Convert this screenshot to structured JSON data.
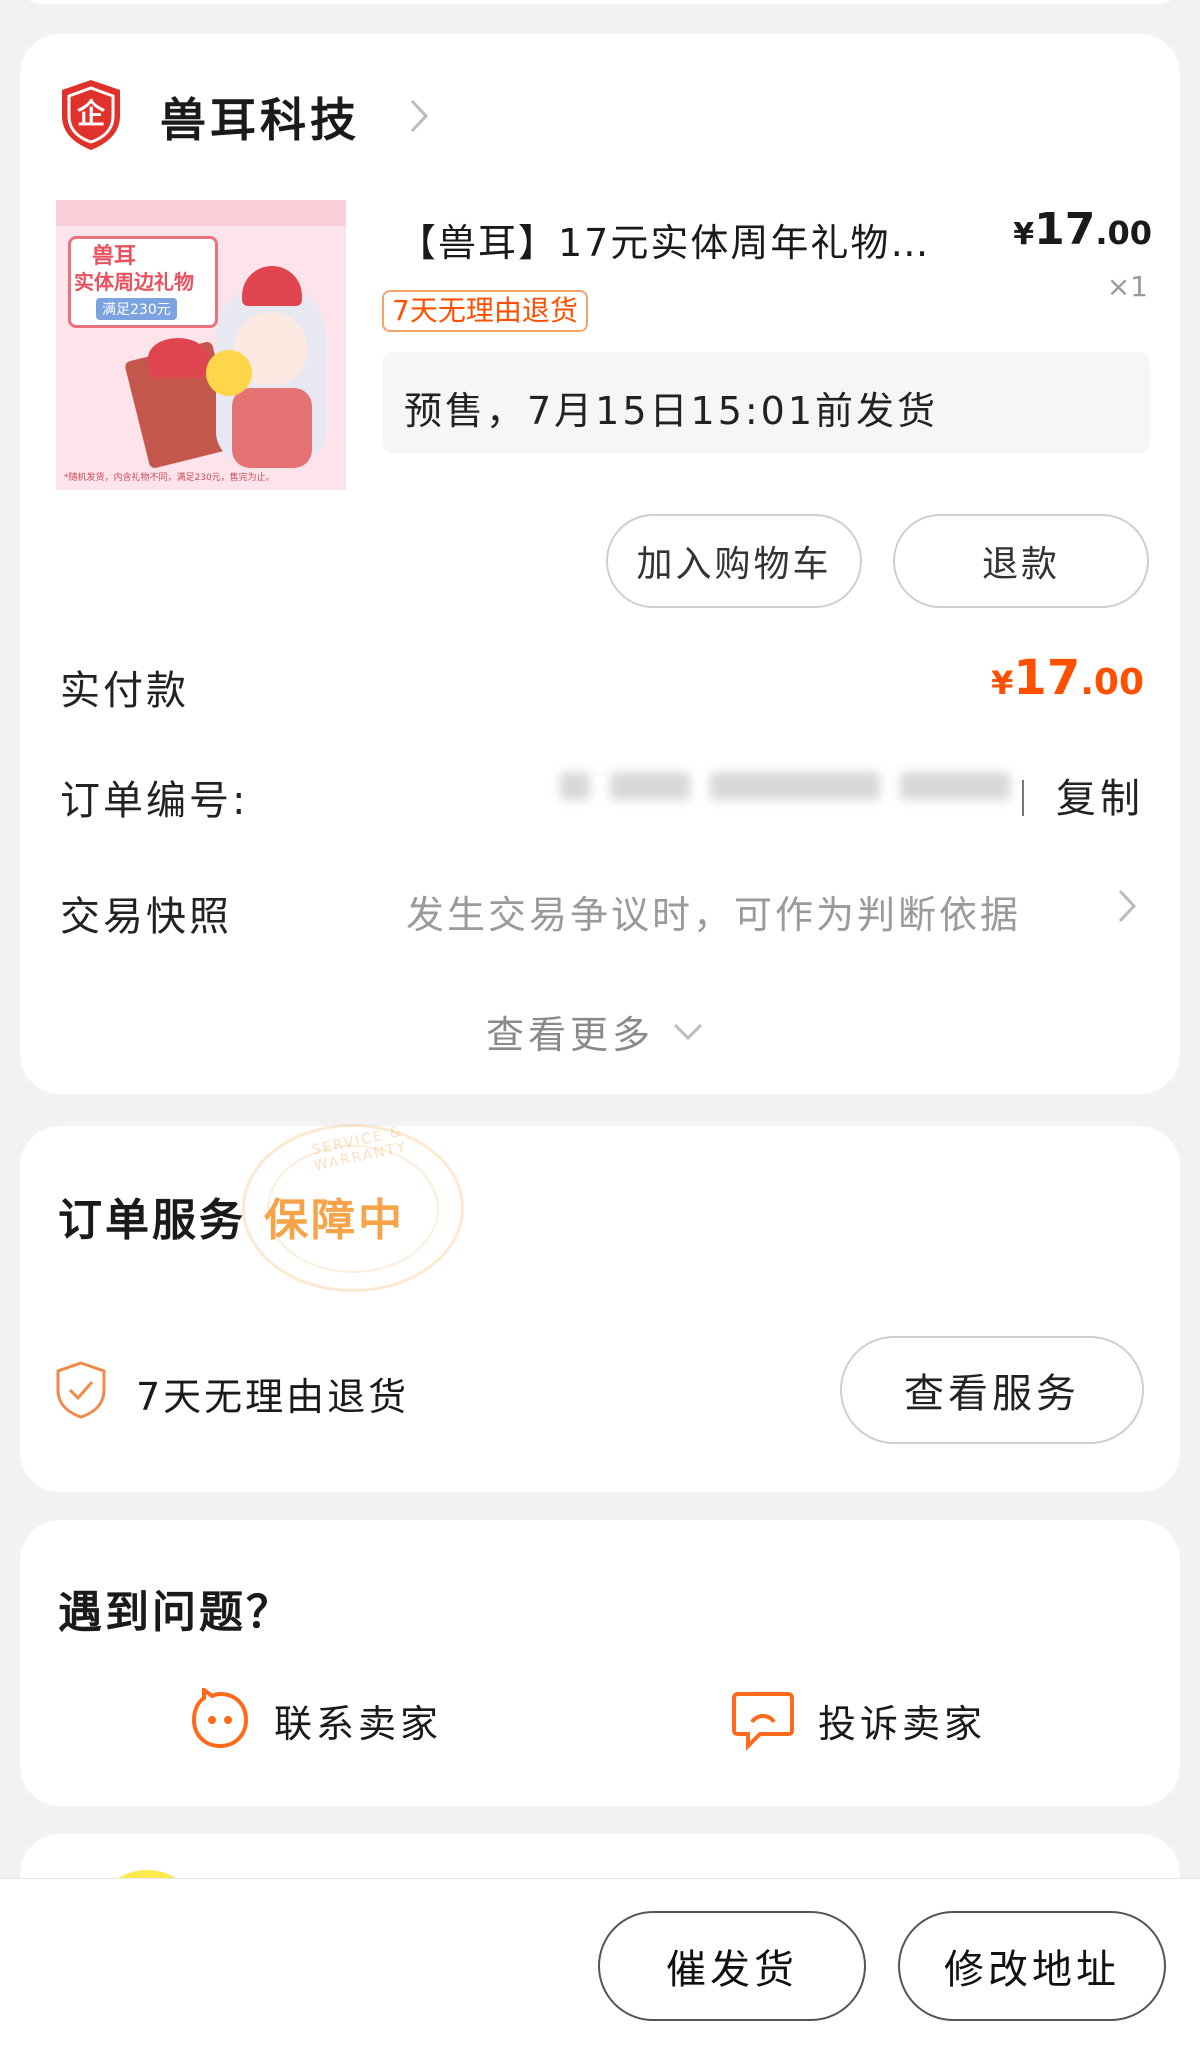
{
  "colors": {
    "accent": "#ff5000",
    "badge_border": "#f4a36b",
    "shield_red": "#e0322a",
    "service_orange": "#f7a34a"
  },
  "store": {
    "name": "兽耳科技",
    "badge_text": "企",
    "icon": "enterprise-shield-icon",
    "arrow_icon": "chevron-right-icon"
  },
  "product": {
    "title": "【兽耳】17元实体周年礼物…",
    "price_symbol": "¥",
    "price_int": "17",
    "price_dec": ".00",
    "quantity": "×1",
    "tag": "7天无理由退货",
    "shipping_note": "预售，7月15日15:01前发货",
    "image": {
      "line1": "兽耳",
      "line2": "实体周边礼物",
      "line3": "满足230元",
      "small_text": "*随机发货，内含礼物不同，满足230元，售完为止。"
    }
  },
  "actions": {
    "add_cart": "加入购物车",
    "refund": "退款"
  },
  "details": {
    "paid_label": "实付款",
    "paid_symbol": "¥",
    "paid_int": "17",
    "paid_dec": ".00",
    "order_label": "订单编号:",
    "copy": "复制",
    "snapshot_label": "交易快照",
    "snapshot_hint": "发生交易争议时，可作为判断依据",
    "more": "查看更多"
  },
  "service": {
    "title": "订单服务",
    "status": "保障中",
    "stamp_text": "SERVICE & WARRANTY",
    "item": "7天无理由退货",
    "button": "查看服务",
    "icon": "shield-check-icon"
  },
  "help": {
    "title": "遇到问题？",
    "contact": "联系卖家",
    "contact_icon": "chat-face-icon",
    "complain": "投诉卖家",
    "complain_icon": "complaint-bubble-icon"
  },
  "bottom": {
    "urge": "催发货",
    "modify": "修改地址"
  }
}
